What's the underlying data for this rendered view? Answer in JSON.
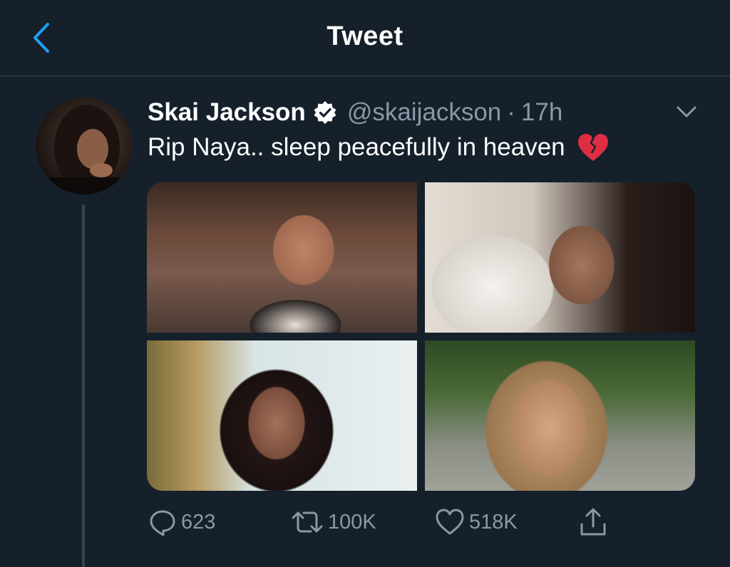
{
  "header": {
    "title": "Tweet",
    "back_icon": "chevron-left-icon"
  },
  "tweet": {
    "display_name": "Skai Jackson",
    "verified_icon": "verified-badge-icon",
    "handle": "@skaijackson",
    "separator": "·",
    "time": "17h",
    "text": "Rip Naya.. sleep peacefully in heaven",
    "emoji_icon": "broken-heart-icon",
    "menu_icon": "chevron-down-icon"
  },
  "actions": {
    "reply_count": "623",
    "retweet_count": "100K",
    "like_count": "518K"
  },
  "colors": {
    "background": "#15202b",
    "accent": "#1da1f2",
    "secondary_text": "#8899a6",
    "divider": "#38444d"
  }
}
